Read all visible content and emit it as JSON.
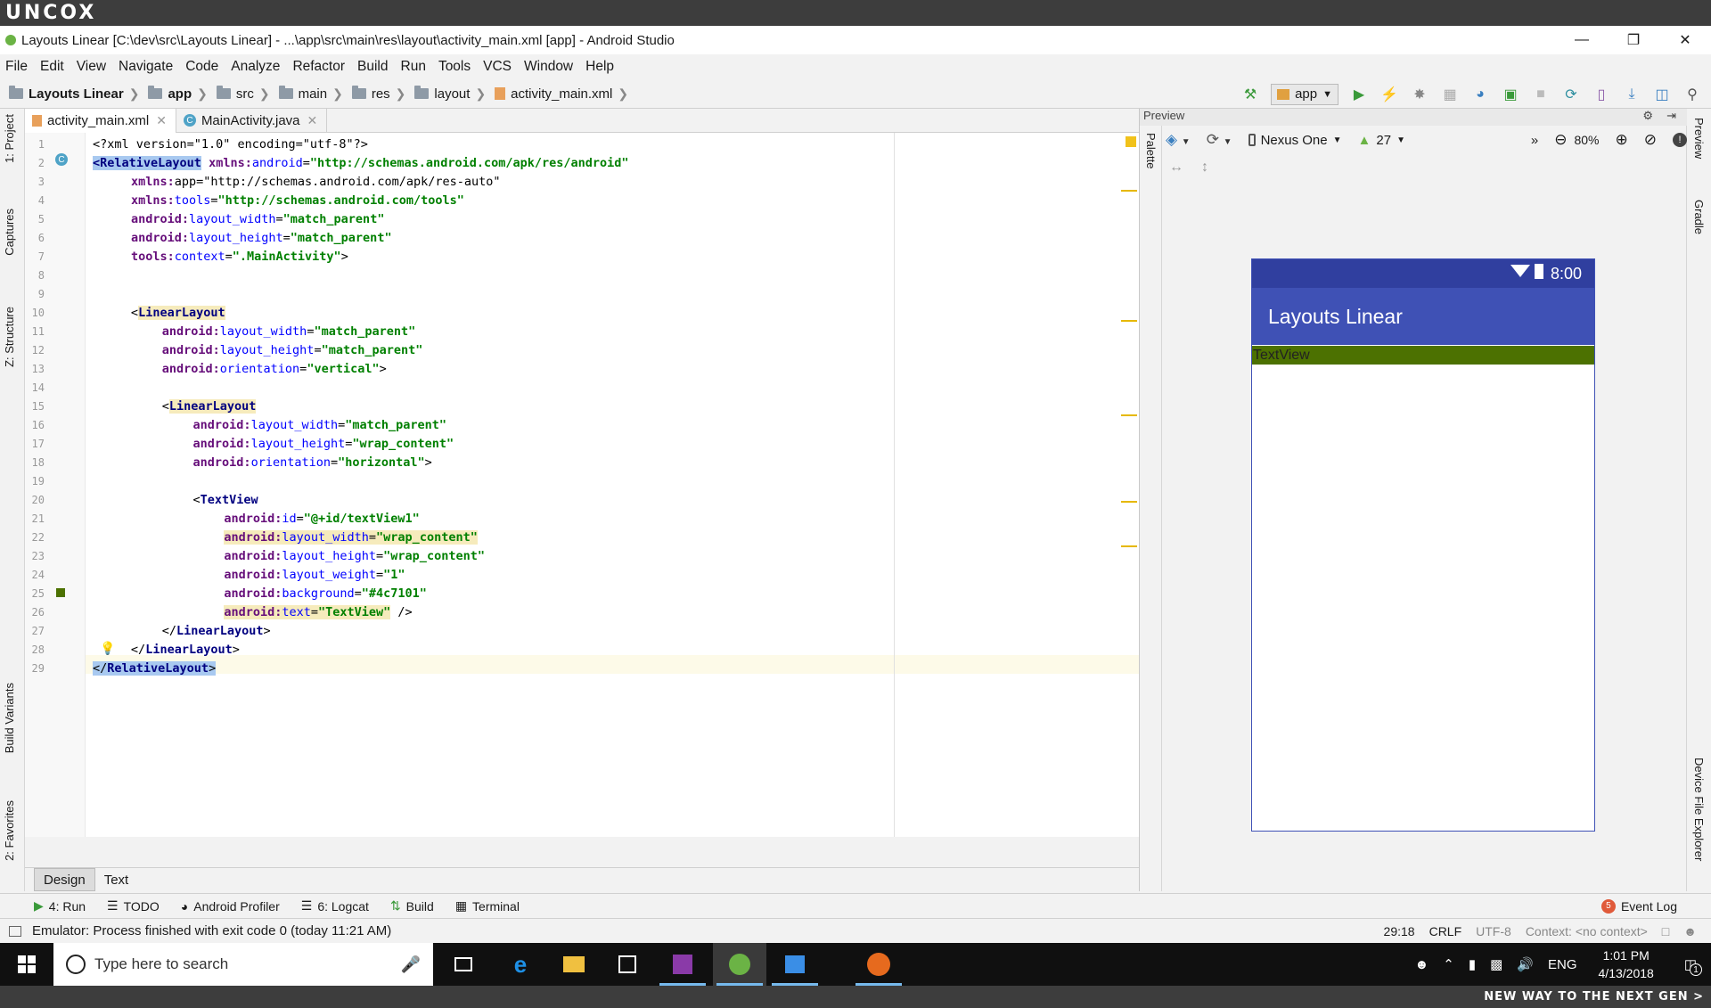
{
  "watermark": {
    "top": "UNCOX",
    "bottom": "NEW WAY TO THE NEXT GEN >"
  },
  "window": {
    "title": "Layouts Linear [C:\\dev\\src\\Layouts Linear] - ...\\app\\src\\main\\res\\layout\\activity_main.xml [app] - Android Studio"
  },
  "menu": [
    "File",
    "Edit",
    "View",
    "Navigate",
    "Code",
    "Analyze",
    "Refactor",
    "Build",
    "Run",
    "Tools",
    "VCS",
    "Window",
    "Help"
  ],
  "breadcrumb": [
    "Layouts Linear",
    "app",
    "src",
    "main",
    "res",
    "layout",
    "activity_main.xml"
  ],
  "toolbar": {
    "run_config": "app"
  },
  "left_tabs": [
    "1: Project",
    "Captures",
    "Z: Structure",
    "Build Variants",
    "2: Favorites"
  ],
  "right_tabs": [
    "Preview",
    "Gradle",
    "Device File Explorer"
  ],
  "file_tabs": [
    "activity_main.xml",
    "MainActivity.java"
  ],
  "editor": {
    "line_numbers": [
      "1",
      "2",
      "3",
      "4",
      "5",
      "6",
      "7",
      "8",
      "9",
      "10",
      "11",
      "12",
      "13",
      "14",
      "15",
      "16",
      "17",
      "18",
      "19",
      "20",
      "21",
      "22",
      "23",
      "24",
      "25",
      "26",
      "27",
      "28",
      "29"
    ],
    "lines": [
      [
        [
          "",
          "<?xml version=\"1.0\" encoding=\"utf-8\"?>"
        ]
      ],
      [
        [
          "tag sel",
          "<RelativeLayout"
        ],
        [
          "",
          " "
        ],
        [
          "ns",
          "xmlns:"
        ],
        [
          "attr",
          "android"
        ],
        [
          "",
          "="
        ],
        [
          "val",
          "\"http://schemas.android.com/apk/res/android\""
        ]
      ],
      [
        [
          "",
          " "
        ],
        [
          "ns",
          "xmlns:"
        ],
        [
          "",
          "app"
        ],
        [
          "",
          "="
        ],
        [
          "",
          "\"http://schemas.android.com/apk/res-auto\""
        ]
      ],
      [
        [
          "",
          " "
        ],
        [
          "ns",
          "xmlns:"
        ],
        [
          "attr",
          "tools"
        ],
        [
          "",
          "="
        ],
        [
          "val",
          "\"http://schemas.android.com/tools\""
        ]
      ],
      [
        [
          "",
          " "
        ],
        [
          "ns",
          "android:"
        ],
        [
          "attr",
          "layout_width"
        ],
        [
          "",
          "="
        ],
        [
          "val",
          "\"match_parent\""
        ]
      ],
      [
        [
          "",
          " "
        ],
        [
          "ns",
          "android:"
        ],
        [
          "attr",
          "layout_height"
        ],
        [
          "",
          "="
        ],
        [
          "val",
          "\"match_parent\""
        ]
      ],
      [
        [
          "",
          " "
        ],
        [
          "ns",
          "tools:"
        ],
        [
          "attr",
          "context"
        ],
        [
          "",
          "="
        ],
        [
          "val",
          "\".MainActivity\""
        ],
        [
          "",
          ">"
        ]
      ],
      [],
      [],
      [
        [
          "",
          " <"
        ],
        [
          "tag hl",
          "LinearLayout"
        ]
      ],
      [
        [
          "",
          " "
        ],
        [
          "ns",
          "android:"
        ],
        [
          "attr",
          "layout_width"
        ],
        [
          "",
          "="
        ],
        [
          "val",
          "\"match_parent\""
        ]
      ],
      [
        [
          "",
          " "
        ],
        [
          "ns",
          "android:"
        ],
        [
          "attr",
          "layout_height"
        ],
        [
          "",
          "="
        ],
        [
          "val",
          "\"match_parent\""
        ]
      ],
      [
        [
          "",
          " "
        ],
        [
          "ns",
          "android:"
        ],
        [
          "attr",
          "orientation"
        ],
        [
          "",
          "="
        ],
        [
          "val",
          "\"vertical\""
        ],
        [
          "",
          ">"
        ]
      ],
      [],
      [
        [
          "",
          " <"
        ],
        [
          "tag hl",
          "LinearLayout"
        ]
      ],
      [
        [
          "",
          " "
        ],
        [
          "ns",
          "android:"
        ],
        [
          "attr",
          "layout_width"
        ],
        [
          "",
          "="
        ],
        [
          "val",
          "\"match_parent\""
        ]
      ],
      [
        [
          "",
          " "
        ],
        [
          "ns",
          "android:"
        ],
        [
          "attr",
          "layout_height"
        ],
        [
          "",
          "="
        ],
        [
          "val",
          "\"wrap_content\""
        ]
      ],
      [
        [
          "",
          " "
        ],
        [
          "ns",
          "android:"
        ],
        [
          "attr",
          "orientation"
        ],
        [
          "",
          "="
        ],
        [
          "val",
          "\"horizontal\""
        ],
        [
          "",
          ">"
        ]
      ],
      [],
      [
        [
          "",
          " <"
        ],
        [
          "tag",
          "TextView"
        ]
      ],
      [
        [
          "",
          " "
        ],
        [
          "ns",
          "android:"
        ],
        [
          "attr",
          "id"
        ],
        [
          "",
          "="
        ],
        [
          "val",
          "\"@+id/textView1\""
        ]
      ],
      [
        [
          "",
          " "
        ],
        [
          "ns hl",
          "android:"
        ],
        [
          "attr hl",
          "layout_width"
        ],
        [
          "hl",
          "="
        ],
        [
          "val hl",
          "\"wrap_content\""
        ]
      ],
      [
        [
          "",
          " "
        ],
        [
          "ns",
          "android:"
        ],
        [
          "attr",
          "layout_height"
        ],
        [
          "",
          "="
        ],
        [
          "val",
          "\"wrap_content\""
        ]
      ],
      [
        [
          "",
          " "
        ],
        [
          "ns",
          "android:"
        ],
        [
          "attr",
          "layout_weight"
        ],
        [
          "",
          "="
        ],
        [
          "val",
          "\"1\""
        ]
      ],
      [
        [
          "",
          " "
        ],
        [
          "ns",
          "android:"
        ],
        [
          "attr",
          "background"
        ],
        [
          "",
          "="
        ],
        [
          "val",
          "\"#4c7101\""
        ]
      ],
      [
        [
          "",
          " "
        ],
        [
          "ns hl",
          "android:"
        ],
        [
          "attr hl",
          "text"
        ],
        [
          "hl",
          "="
        ],
        [
          "val hl",
          "\"TextView\""
        ],
        [
          "",
          " />"
        ]
      ],
      [
        [
          "",
          " </"
        ],
        [
          "tag",
          "LinearLayout"
        ],
        [
          "",
          ">"
        ]
      ],
      [
        [
          "",
          " </"
        ],
        [
          "tag",
          "LinearLayout"
        ],
        [
          "",
          ">"
        ]
      ],
      [
        [
          "sel",
          "</"
        ],
        [
          "tag sel",
          "RelativeLayout"
        ],
        [
          "sel",
          ">"
        ]
      ]
    ]
  },
  "bottom_tabs": [
    "Design",
    "Text"
  ],
  "tool_windows": [
    "4: Run",
    "TODO",
    "Android Profiler",
    "6: Logcat",
    "Build",
    "Terminal"
  ],
  "event_log": {
    "label": "Event Log",
    "count": "5"
  },
  "status": {
    "message": "Emulator: Process finished with exit code 0 (today 11:21 AM)",
    "position": "29:18",
    "line_sep": "CRLF",
    "encoding": "UTF-8",
    "context": "Context: <no context>"
  },
  "preview": {
    "header": "Preview",
    "palette": "Palette",
    "device": "Nexus One",
    "api": "27",
    "zoom": "80%",
    "time": "8:00",
    "app_title": "Layouts Linear",
    "textview": "TextView",
    "textview_bg": "#4c7101",
    "appbar_color": "#3f51b5"
  },
  "taskbar": {
    "search_placeholder": "Type here to search",
    "lang": "ENG",
    "time": "1:01 PM",
    "date": "4/13/2018",
    "notifications": "1"
  }
}
